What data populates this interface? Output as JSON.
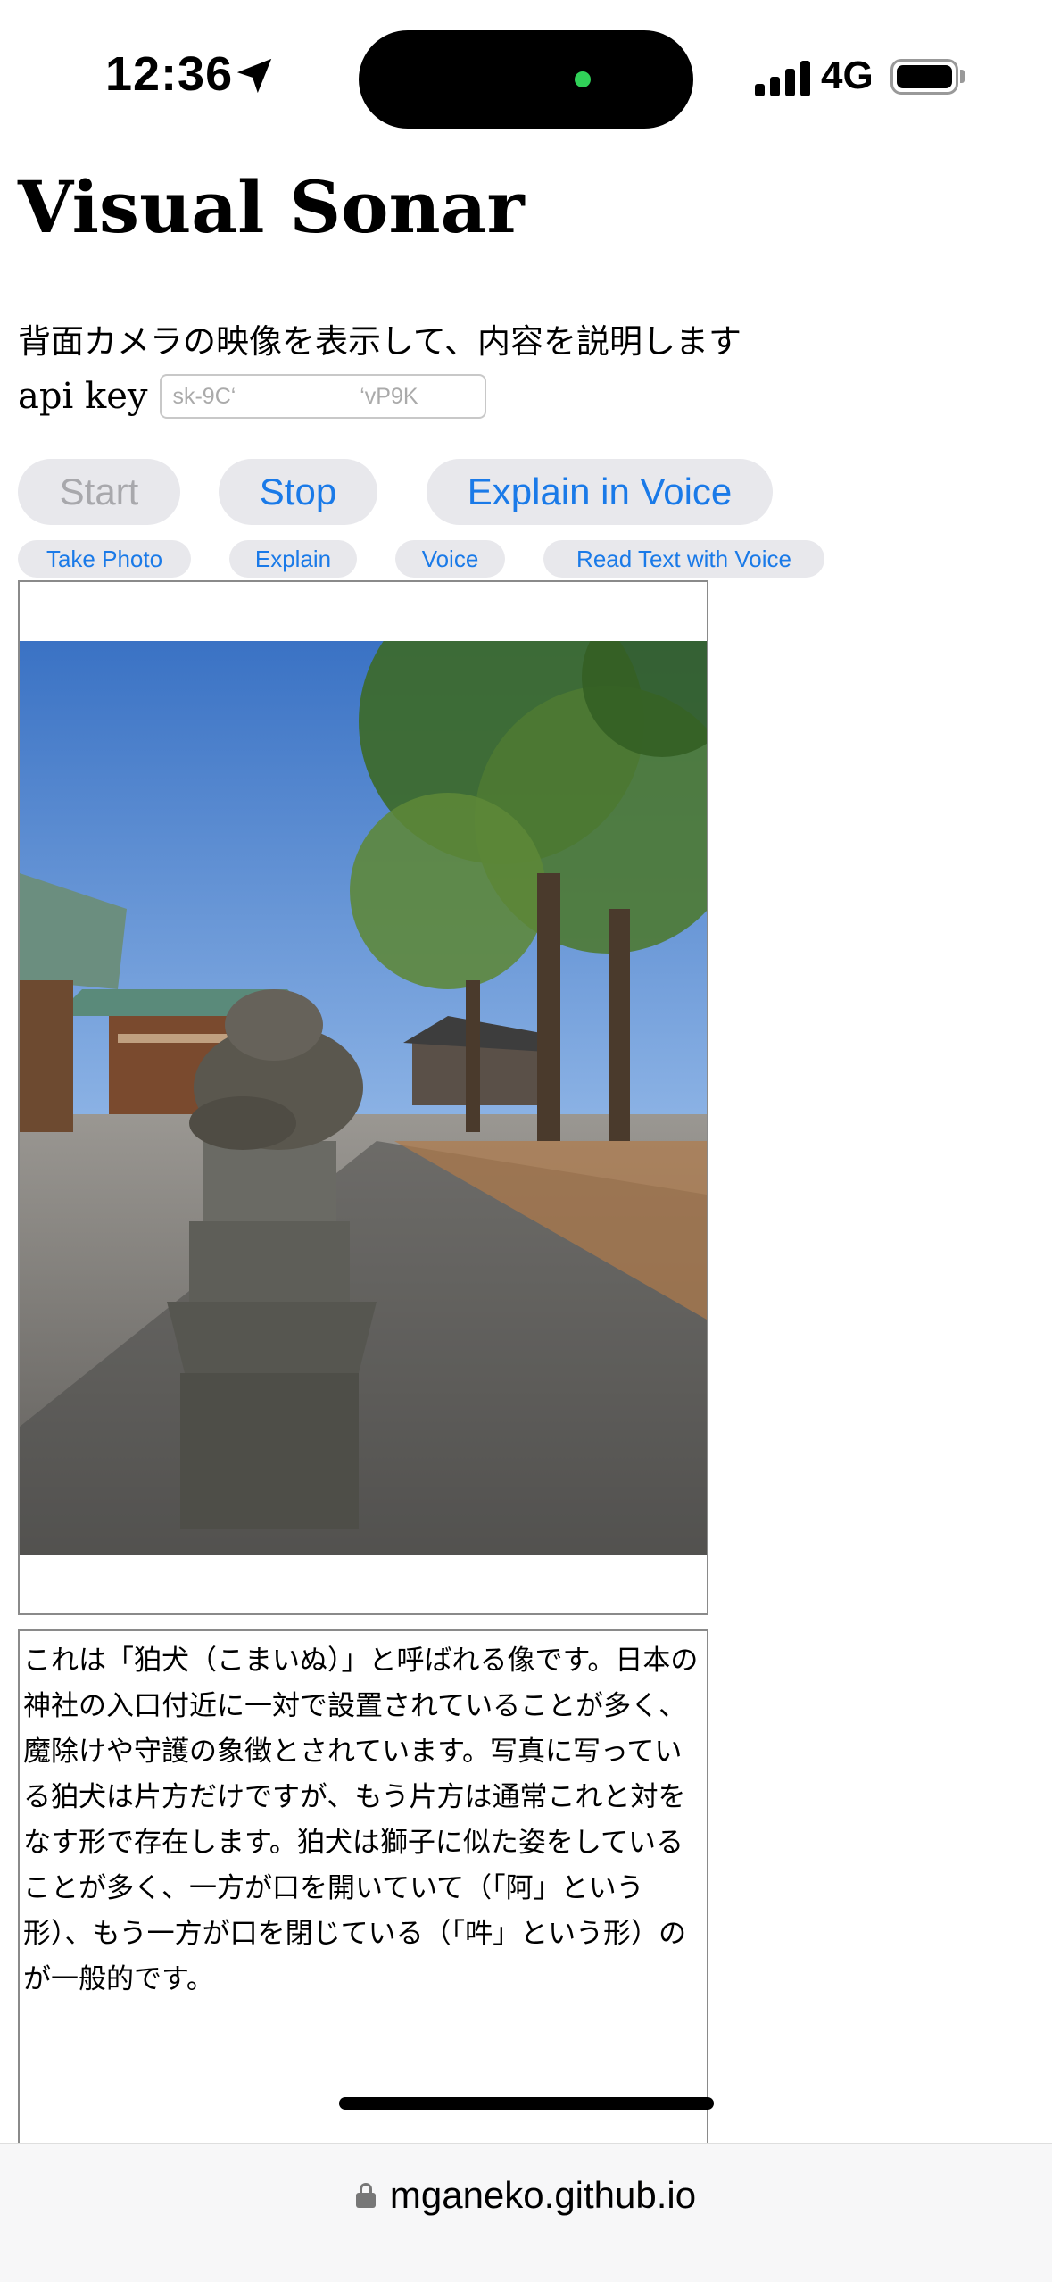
{
  "status_bar": {
    "time": "12:36",
    "network": "4G",
    "icons": [
      "location-arrow-icon",
      "signal-icon",
      "battery-icon"
    ]
  },
  "page": {
    "title": "Visual Sonar",
    "description": "背面カメラの映像を表示して、内容を説明します",
    "api_key": {
      "label": "api key",
      "value": "sk-9C‘                    ‘vP9K"
    },
    "buttons": {
      "start": "Start",
      "stop": "Stop",
      "explain_voice": "Explain in Voice",
      "take_photo": "Take Photo",
      "explain": "Explain",
      "voice": "Voice",
      "read_text": "Read Text with Voice"
    },
    "output_text": "これは「狛犬（こまいぬ）」と呼ばれる像です。日本の神社の入口付近に一対で設置されていることが多く、魔除けや守護の象徴とされています。写真に写っている狛犬は片方だけですが、もう片方は通常これと対をなす形で存在します。狛犬は獅子に似た姿をしていることが多く、一方が口を開いていて（「阿」という形）、もう一方が口を閉じている（「吽」という形）のが一般的です。"
  },
  "browser": {
    "url": "mganeko.github.io"
  },
  "colors": {
    "accent": "#1a7ae8",
    "button_bg": "#e8e8ec",
    "disabled_text": "#a8a8ac",
    "border": "#8a8a8a"
  }
}
